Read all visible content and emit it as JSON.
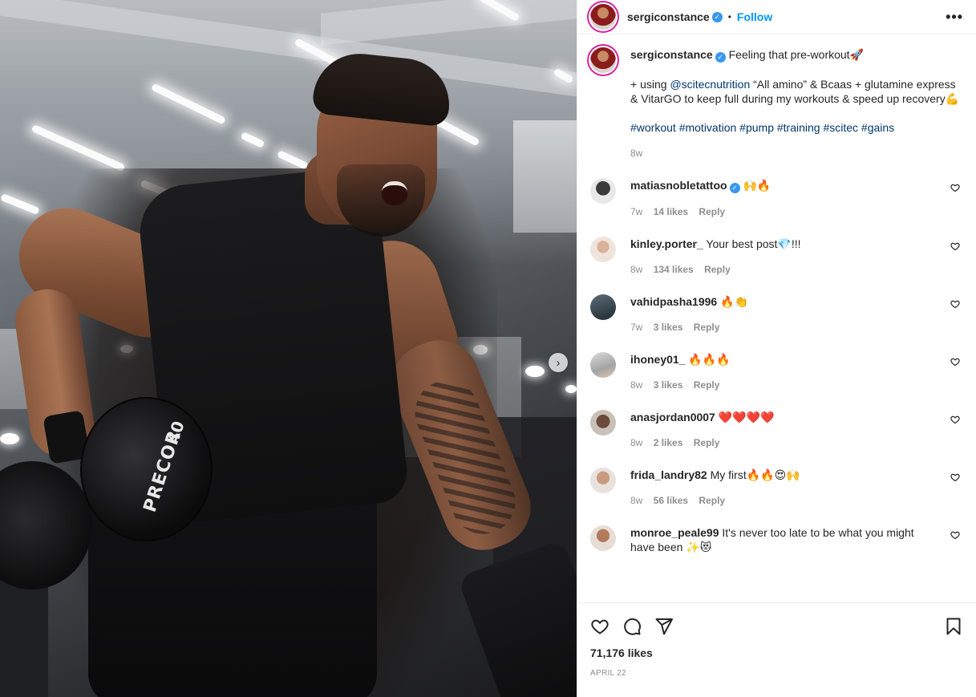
{
  "post": {
    "author": "sergiconstance",
    "follow_label": "Follow",
    "separator": "•",
    "more_label": "•••",
    "next_label": "›",
    "dumbbell_brand": "PRECOR",
    "dumbbell_weight": "40"
  },
  "caption": {
    "username": "sergiconstance",
    "line1": "Feeling that pre-workout🚀",
    "line2_prefix": "+ using ",
    "mention": "@scitecnutrition",
    "line2_rest": " “All amino” & Bcaas + glutamine express & VitarGO to keep full during my workouts & speed up recovery💪",
    "hashtags": "#workout #motivation #pump #training #scitec #gains",
    "time": "8w"
  },
  "comments": [
    {
      "username": "matiasnobletattoo",
      "verified": true,
      "text": "🙌🔥",
      "time": "7w",
      "likes": "14 likes",
      "reply": "Reply"
    },
    {
      "username": "kinley.porter_",
      "verified": false,
      "text": "Your best post💎!!!",
      "time": "8w",
      "likes": "134 likes",
      "reply": "Reply"
    },
    {
      "username": "vahidpasha1996",
      "verified": false,
      "text": "🔥👏",
      "time": "7w",
      "likes": "3 likes",
      "reply": "Reply"
    },
    {
      "username": "ihoney01_",
      "verified": false,
      "text": "🔥🔥🔥",
      "time": "8w",
      "likes": "3 likes",
      "reply": "Reply"
    },
    {
      "username": "anasjordan0007",
      "verified": false,
      "text": "❤️❤️❤️❤️",
      "time": "8w",
      "likes": "2 likes",
      "reply": "Reply"
    },
    {
      "username": "frida_landry82",
      "verified": false,
      "text": "My first🔥🔥😍🙌",
      "time": "8w",
      "likes": "56 likes",
      "reply": "Reply"
    },
    {
      "username": "monroe_peale99",
      "verified": false,
      "text": "It's never too late to be what you might have been ✨😻",
      "time": "",
      "likes": "",
      "reply": ""
    }
  ],
  "footer": {
    "likes": "71,176 likes",
    "date": "APRIL 22"
  },
  "colors": {
    "accent": "#0095f6",
    "verified": "#3897f0",
    "muted": "#8e8e8e",
    "link": "#00376b"
  },
  "icons": [
    "heart-icon",
    "comment-icon",
    "share-icon",
    "bookmark-icon",
    "more-options-icon",
    "chevron-right-icon",
    "verified-badge-icon"
  ]
}
